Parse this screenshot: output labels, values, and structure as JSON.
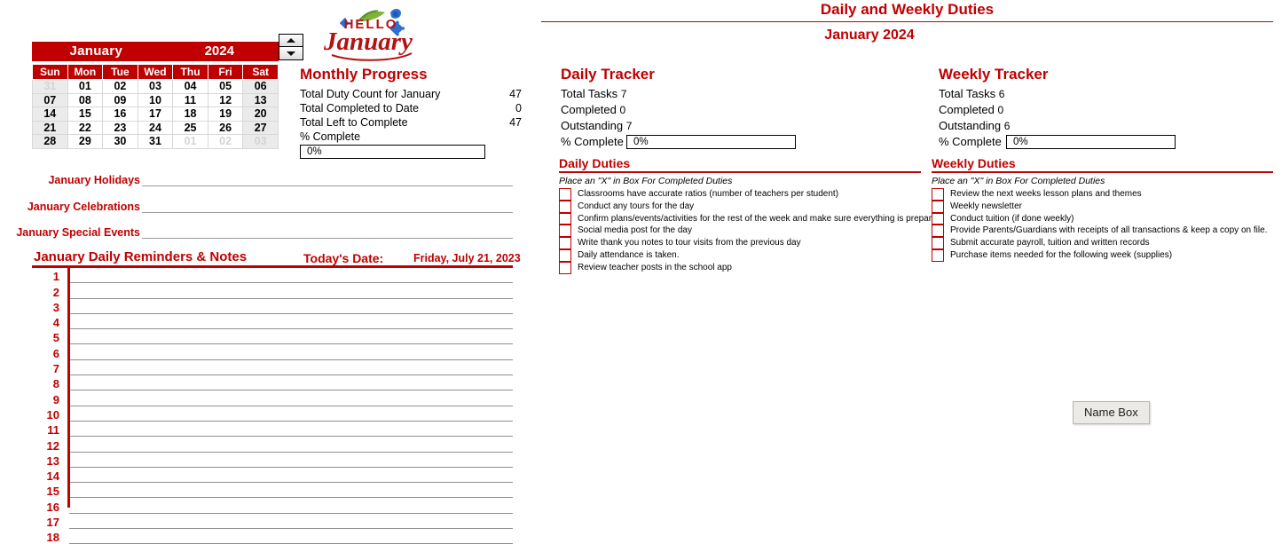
{
  "calendar": {
    "month": "January",
    "year": "2024",
    "weekday_headers": [
      "Sun",
      "Mon",
      "Tue",
      "Wed",
      "Thu",
      "Fri",
      "Sat"
    ],
    "weeks": [
      [
        {
          "d": "31",
          "out": true
        },
        {
          "d": "01",
          "out": false
        },
        {
          "d": "02",
          "out": false
        },
        {
          "d": "03",
          "out": false
        },
        {
          "d": "04",
          "out": false
        },
        {
          "d": "05",
          "out": false
        },
        {
          "d": "06",
          "out": false
        }
      ],
      [
        {
          "d": "07",
          "out": false
        },
        {
          "d": "08",
          "out": false
        },
        {
          "d": "09",
          "out": false
        },
        {
          "d": "10",
          "out": false
        },
        {
          "d": "11",
          "out": false
        },
        {
          "d": "12",
          "out": false
        },
        {
          "d": "13",
          "out": false
        }
      ],
      [
        {
          "d": "14",
          "out": false
        },
        {
          "d": "15",
          "out": false
        },
        {
          "d": "16",
          "out": false
        },
        {
          "d": "17",
          "out": false
        },
        {
          "d": "18",
          "out": false
        },
        {
          "d": "19",
          "out": false
        },
        {
          "d": "20",
          "out": false
        }
      ],
      [
        {
          "d": "21",
          "out": false
        },
        {
          "d": "22",
          "out": false
        },
        {
          "d": "23",
          "out": false
        },
        {
          "d": "24",
          "out": false
        },
        {
          "d": "25",
          "out": false
        },
        {
          "d": "26",
          "out": false
        },
        {
          "d": "27",
          "out": false
        }
      ],
      [
        {
          "d": "28",
          "out": false
        },
        {
          "d": "29",
          "out": false
        },
        {
          "d": "30",
          "out": false
        },
        {
          "d": "31",
          "out": false
        },
        {
          "d": "01",
          "out": true
        },
        {
          "d": "02",
          "out": true
        },
        {
          "d": "03",
          "out": true
        }
      ]
    ],
    "spinner_up_icon": "spinner-up-arrow",
    "spinner_down_icon": "spinner-down-arrow"
  },
  "logo": {
    "hello_text": "HELLO",
    "month_text": "January",
    "icon": "hello-january-wreath-logo"
  },
  "monthly_progress": {
    "title": "Monthly Progress",
    "rows": [
      {
        "label": "Total Duty Count for January",
        "value": "47"
      },
      {
        "label": "Total Completed to Date",
        "value": "0"
      },
      {
        "label": "Total Left to Complete",
        "value": "47"
      }
    ],
    "pct_label": "% Complete",
    "pct_value": "0%"
  },
  "info_rows": [
    {
      "label": "January Holidays",
      "value": ""
    },
    {
      "label": "January Celebrations",
      "value": ""
    },
    {
      "label": "January Special Events",
      "value": ""
    }
  ],
  "reminders": {
    "title": "January Daily Reminders & Notes",
    "date_label": "Today's Date:",
    "date_value": "Friday, July 21, 2023",
    "numbers": [
      "1",
      "2",
      "3",
      "4",
      "5",
      "6",
      "7",
      "8",
      "9",
      "10",
      "11",
      "12",
      "13",
      "14",
      "15",
      "16",
      "17",
      "18"
    ]
  },
  "header": {
    "title": "Daily and Weekly Duties",
    "subtitle": "January 2024"
  },
  "daily_tracker": {
    "title": "Daily Tracker",
    "total_tasks_label": "Total Tasks",
    "total_tasks_value": "7",
    "completed_label": "Completed",
    "completed_value": "0",
    "outstanding_label": "Outstanding",
    "outstanding_value": "7",
    "pct_label": "% Complete",
    "pct_value": "0%"
  },
  "weekly_tracker": {
    "title": "Weekly Tracker",
    "total_tasks_label": "Total Tasks",
    "total_tasks_value": "6",
    "completed_label": "Completed",
    "completed_value": "0",
    "outstanding_label": "Outstanding",
    "outstanding_value": "6",
    "pct_label": "% Complete",
    "pct_value": "0%"
  },
  "daily_duties": {
    "title": "Daily Duties",
    "instruction": "Place an \"X\" in Box For Completed Duties",
    "items": [
      "Classrooms have accurate ratios (number of teachers per student)",
      "Conduct any tours for the day",
      "Confirm plans/events/activities for the rest of the week and make sure everything is prepared.",
      "Social media post for the day",
      "Write thank you notes to tour visits from the previous day",
      "Daily attendance is taken.",
      "Review teacher posts in the school app"
    ]
  },
  "weekly_duties": {
    "title": "Weekly Duties",
    "instruction": "Place an \"X\" in Box For Completed Duties",
    "items": [
      "Review the next weeks lesson plans and themes",
      "Weekly newsletter",
      "Conduct tuition (if done weekly)",
      "Provide Parents/Guardians with receipts of all transactions & keep a copy on file.",
      "Submit accurate payroll, tuition and written records",
      "Purchase items needed for the following week (supplies)"
    ]
  },
  "name_box": {
    "label": "Name Box"
  },
  "colors": {
    "brand_red": "#C00000",
    "weekend_cell": "#ebebeb",
    "out_of_month_text": "#d4d4d4",
    "rule_gray": "#9a9a9a"
  }
}
